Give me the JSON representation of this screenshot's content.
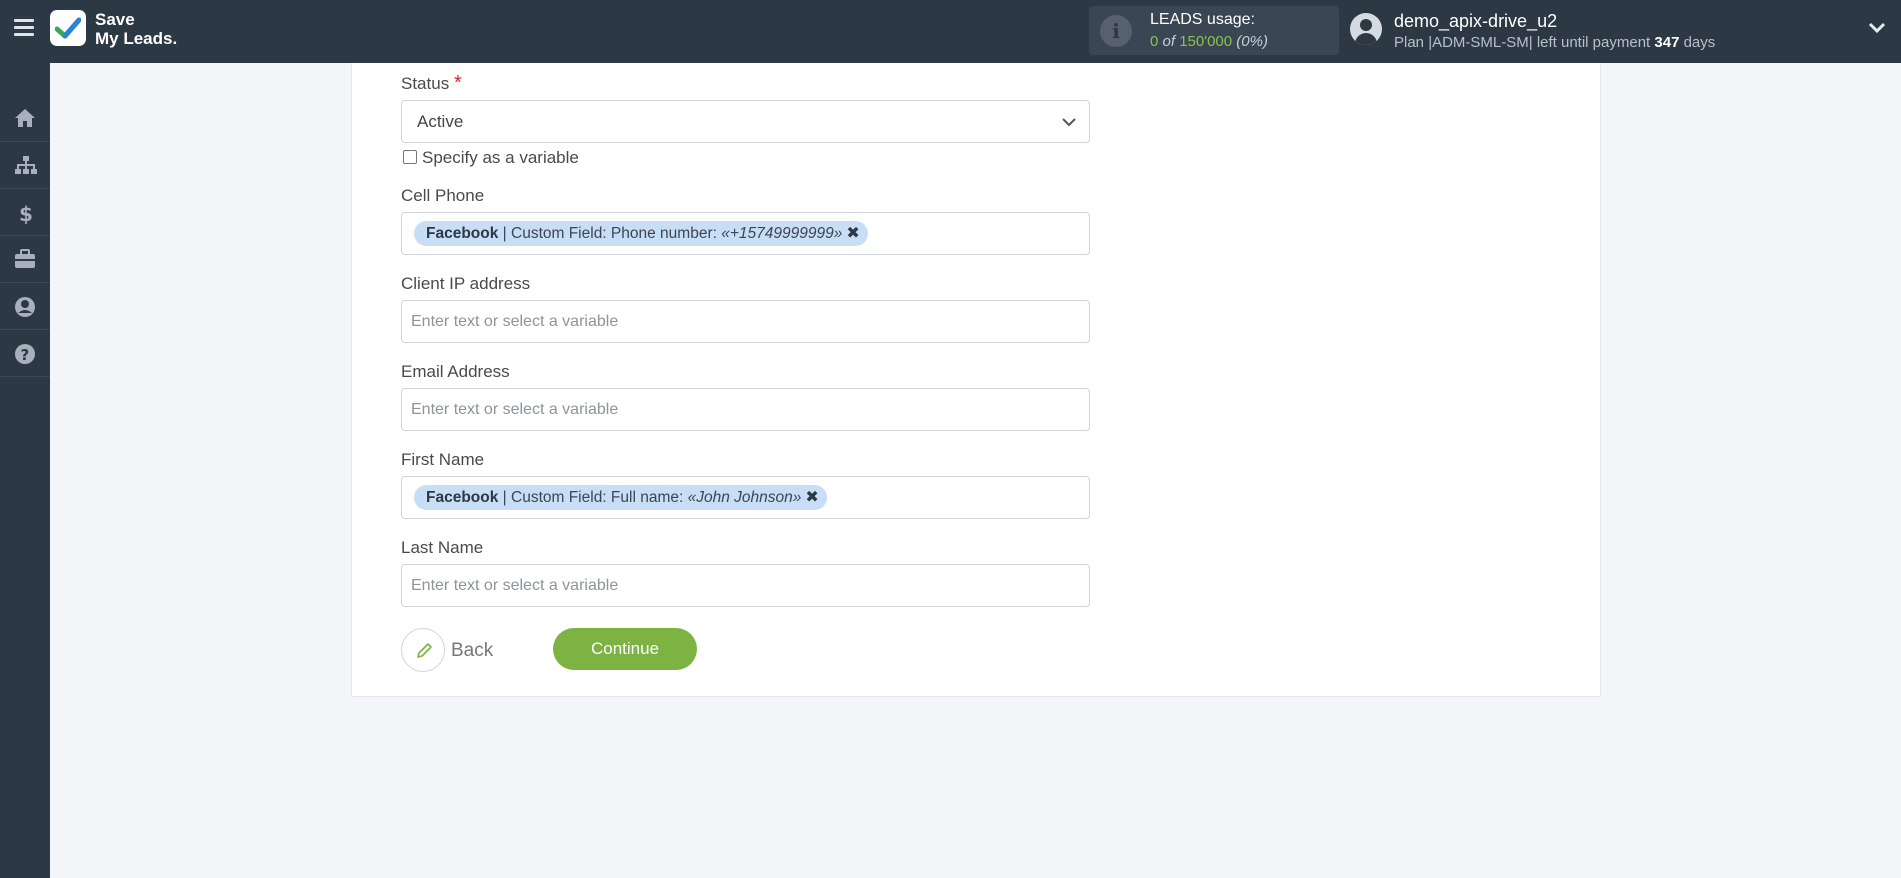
{
  "app": {
    "logo_line1": "Save",
    "logo_line2": "My Leads."
  },
  "header": {
    "leads_title": "LEADS usage:",
    "leads_used": "0",
    "leads_of": "of",
    "leads_limit": "150'000",
    "leads_percent": "(0%)",
    "user_name": "demo_apix-drive_u2",
    "plan_prefix": "Plan |ADM-SML-SM| left until payment",
    "plan_days": "347",
    "plan_suffix": "days"
  },
  "sidebar": {
    "items": [
      "home-icon",
      "sitemap-icon",
      "dollar-icon",
      "briefcase-icon",
      "user-icon",
      "help-icon"
    ]
  },
  "form": {
    "status": {
      "label": "Status",
      "required_mark": "*",
      "value": "Active"
    },
    "specify_variable": "Specify as a variable",
    "cell_phone": {
      "label": "Cell Phone",
      "tag_source": "Facebook",
      "tag_text": "| Custom Field: Phone number:",
      "tag_value": "«+15749999999»"
    },
    "client_ip": {
      "label": "Client IP address",
      "placeholder": "Enter text or select a variable"
    },
    "email": {
      "label": "Email Address",
      "placeholder": "Enter text or select a variable"
    },
    "first_name": {
      "label": "First Name",
      "tag_source": "Facebook",
      "tag_text": "| Custom Field: Full name:",
      "tag_value": "«John Johnson»"
    },
    "last_name": {
      "label": "Last Name",
      "placeholder": "Enter text or select a variable"
    },
    "tag_remove": "✖"
  },
  "actions": {
    "back": "Back",
    "continue": "Continue"
  },
  "colors": {
    "accent": "#7cb342",
    "topbar": "#2c3844",
    "tag": "#c8ddf6"
  }
}
